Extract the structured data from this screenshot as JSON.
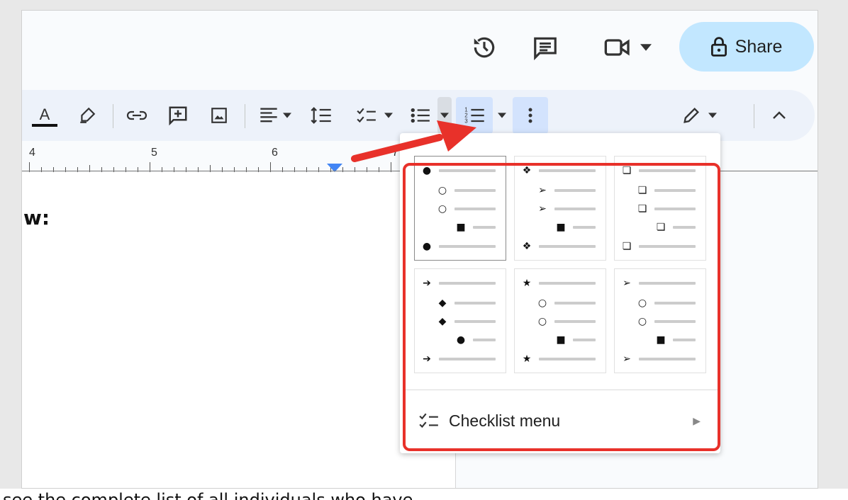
{
  "header": {
    "share_label": "Share"
  },
  "icons": {
    "version_history": "history-icon",
    "comments": "comment-icon",
    "meet": "video-camera-icon",
    "share_lock": "lock-icon"
  },
  "colors": {
    "share_bg": "#c2e7ff",
    "toolbar_bg": "#edf2fa",
    "active_btn": "#d3e3fd",
    "annotation_red": "#e8312a",
    "ruler_marker": "#4285f4"
  },
  "ruler": {
    "numbers": [
      "4",
      "5",
      "6",
      "7"
    ]
  },
  "document": {
    "visible_text": "w:",
    "bottom_text": "see the complete list of all individuals who have"
  },
  "menu": {
    "presets": [
      {
        "rows": [
          "●",
          "○",
          "○",
          "■",
          "●"
        ]
      },
      {
        "rows": [
          "❖",
          "➢",
          "➢",
          "■",
          "❖"
        ]
      },
      {
        "rows": [
          "❏",
          "❏",
          "❏",
          "❏",
          "❏"
        ]
      },
      {
        "rows": [
          "➔",
          "◆",
          "◆",
          "●",
          "➔"
        ]
      },
      {
        "rows": [
          "★",
          "○",
          "○",
          "■",
          "★"
        ]
      },
      {
        "rows": [
          "➢",
          "○",
          "○",
          "■",
          "➢"
        ]
      }
    ],
    "checklist_label": "Checklist menu",
    "submenu_arrow": "▶"
  }
}
